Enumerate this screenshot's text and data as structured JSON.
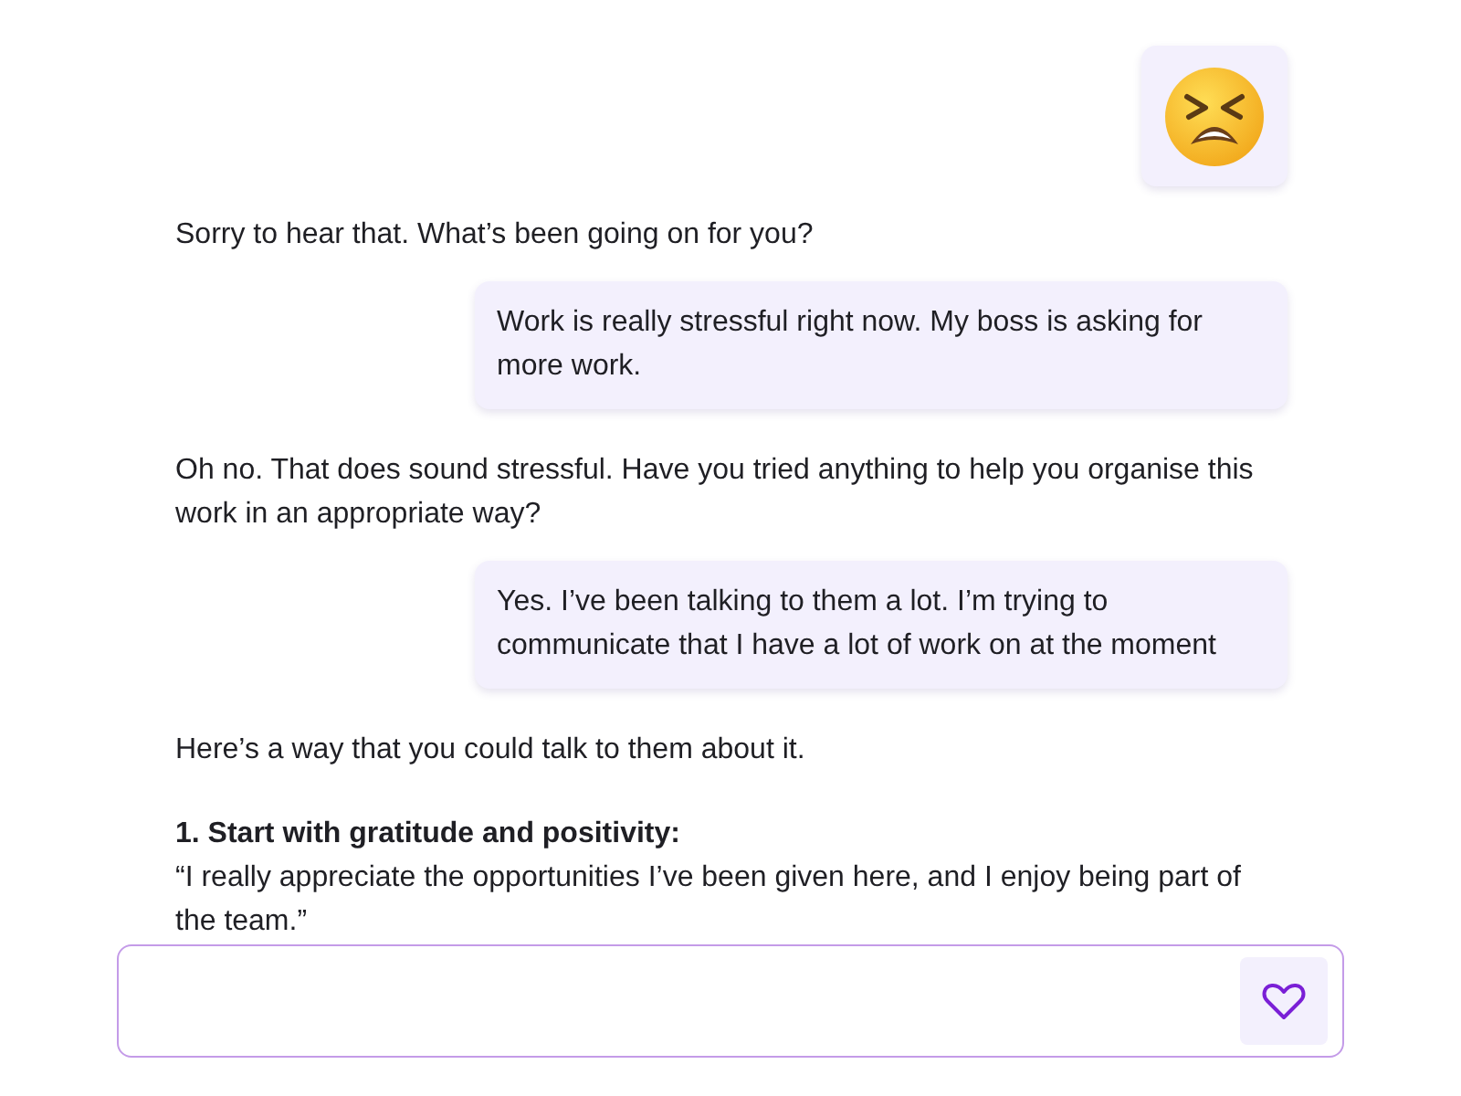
{
  "messages": [
    {
      "kind": "emoji"
    },
    {
      "kind": "bot",
      "blocks": [
        {
          "kind": "text",
          "text": "Sorry to hear that. What’s been going on for you?"
        }
      ]
    },
    {
      "kind": "user",
      "text": "Work is really stressful right now. My boss is asking for more work."
    },
    {
      "kind": "bot",
      "blocks": [
        {
          "kind": "text",
          "text": "Oh no. That does sound stressful. Have you tried anything to help you organise this work in an appropriate way?"
        }
      ]
    },
    {
      "kind": "user",
      "text": "Yes. I’ve been talking to them a lot. I’m trying to communicate that I have a lot of work on at the moment"
    },
    {
      "kind": "bot",
      "blocks": [
        {
          "kind": "text",
          "text": "Here’s a way that you could talk to them about it."
        },
        {
          "kind": "heading",
          "text": "1. Start with gratitude and positivity:"
        },
        {
          "kind": "text",
          "text": "“I really appreciate the opportunities I’ve been given here, and I enjoy being part of the team.”"
        }
      ]
    }
  ],
  "composer": {
    "kind": "input"
  }
}
